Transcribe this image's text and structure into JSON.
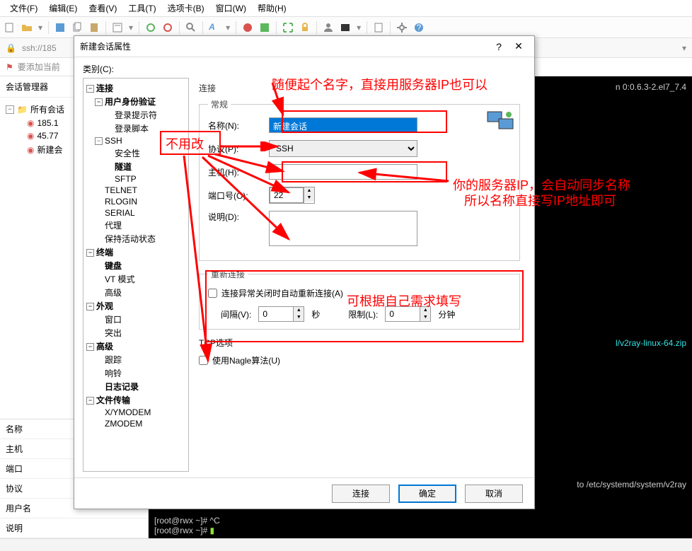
{
  "menu": {
    "file": "文件(F)",
    "edit": "编辑(E)",
    "view": "查看(V)",
    "tools": "工具(T)",
    "tabs": "选项卡(B)",
    "window": "窗口(W)",
    "help": "帮助(H)"
  },
  "addr": {
    "url": "ssh://185"
  },
  "bookmark": {
    "add": "要添加当前"
  },
  "leftPanel": {
    "title": "会话管理器",
    "root": "所有会话",
    "items": [
      "185.1",
      "45.77",
      "新建会"
    ],
    "props": [
      "名称",
      "主机",
      "端口",
      "协议",
      "用户名",
      "说明"
    ]
  },
  "terminal": {
    "l1": "n 0:0.6.3-2.el7_7.4",
    "l2": "l/v2ray-linux-64.zip",
    "l3": "to /etc/systemd/system/v2ray",
    "p1": "[root@rwx ~]# ^C",
    "p2": "[root@rwx ~]# "
  },
  "dialog": {
    "title": "新建会话属性",
    "categoryLabel": "类别(C):",
    "tree": {
      "connection": "连接",
      "userAuth": "用户身份验证",
      "loginPrompt": "登录提示符",
      "loginScript": "登录脚本",
      "ssh": "SSH",
      "security": "安全性",
      "tunnel": "隧道",
      "sftp": "SFTP",
      "telnet": "TELNET",
      "rlogin": "RLOGIN",
      "serial": "SERIAL",
      "proxy": "代理",
      "keepAlive": "保持活动状态",
      "terminal": "终端",
      "keyboard": "键盘",
      "vtmode": "VT 模式",
      "advancedT": "高级",
      "appearance": "外观",
      "window": "窗口",
      "highlight": "突出",
      "advanced": "高级",
      "trace": "跟踪",
      "bell": "响铃",
      "logging": "日志记录",
      "fileTransfer": "文件传输",
      "xymodem": "X/YMODEM",
      "zmodem": "ZMODEM"
    },
    "form": {
      "connHeader": "连接",
      "general": "常规",
      "nameLabel": "名称(N):",
      "nameValue": "新建会话",
      "protoLabel": "协议(P):",
      "protoValue": "SSH",
      "hostLabel": "主机(H):",
      "hostValue": "",
      "portLabel": "端口号(O):",
      "portValue": "22",
      "descLabel": "说明(D):",
      "descValue": "",
      "reconnectHeader": "重新连接",
      "reconnectChk": "连接异常关闭时自动重新连接(A)",
      "intervalLabel": "间隔(V):",
      "intervalValue": "0",
      "secUnit": "秒",
      "limitLabel": "限制(L):",
      "limitValue": "0",
      "minUnit": "分钟",
      "tcpHeader": "TCP选项",
      "nagleChk": "使用Nagle算法(U)"
    },
    "buttons": {
      "connect": "连接",
      "ok": "确定",
      "cancel": "取消"
    }
  },
  "annotations": {
    "a1": "随便起个名字，直接用服务器IP也可以",
    "a2": "不用改",
    "a3": "你的服务器IP，会自动同步名称",
    "a3b": "所以名称直接写IP地址即可",
    "a4": "可根据自己需求填写"
  }
}
